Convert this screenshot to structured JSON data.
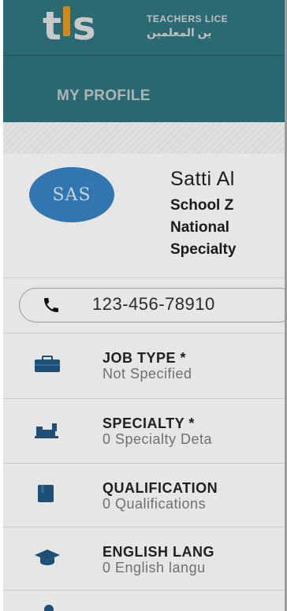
{
  "header": {
    "brand_en": "TEACHERS LICE",
    "brand_ar": "ين المعلمين",
    "tab_label": "MY PROFILE"
  },
  "profile": {
    "initials": "SAS",
    "name": "Satti Al",
    "line1": "School Z",
    "line2": "National",
    "line3": "Specialty"
  },
  "phone": {
    "number": "123-456-78910"
  },
  "items": [
    {
      "title": "JOB TYPE *",
      "subtitle": "Not Specified",
      "icon": "briefcase-icon"
    },
    {
      "title": "SPECIALTY *",
      "subtitle": "0 Specialty Deta",
      "icon": "specialty-icon"
    },
    {
      "title": "QUALIFICATION",
      "subtitle": "0 Qualifications",
      "icon": "book-icon"
    },
    {
      "title": "ENGLISH LANG",
      "subtitle": "0 English langu",
      "icon": "graduation-cap-icon"
    }
  ],
  "colors": {
    "header": "#2c6a73",
    "avatar": "#3176b0",
    "accent": "#c98a25",
    "icon": "#1f4f77"
  }
}
